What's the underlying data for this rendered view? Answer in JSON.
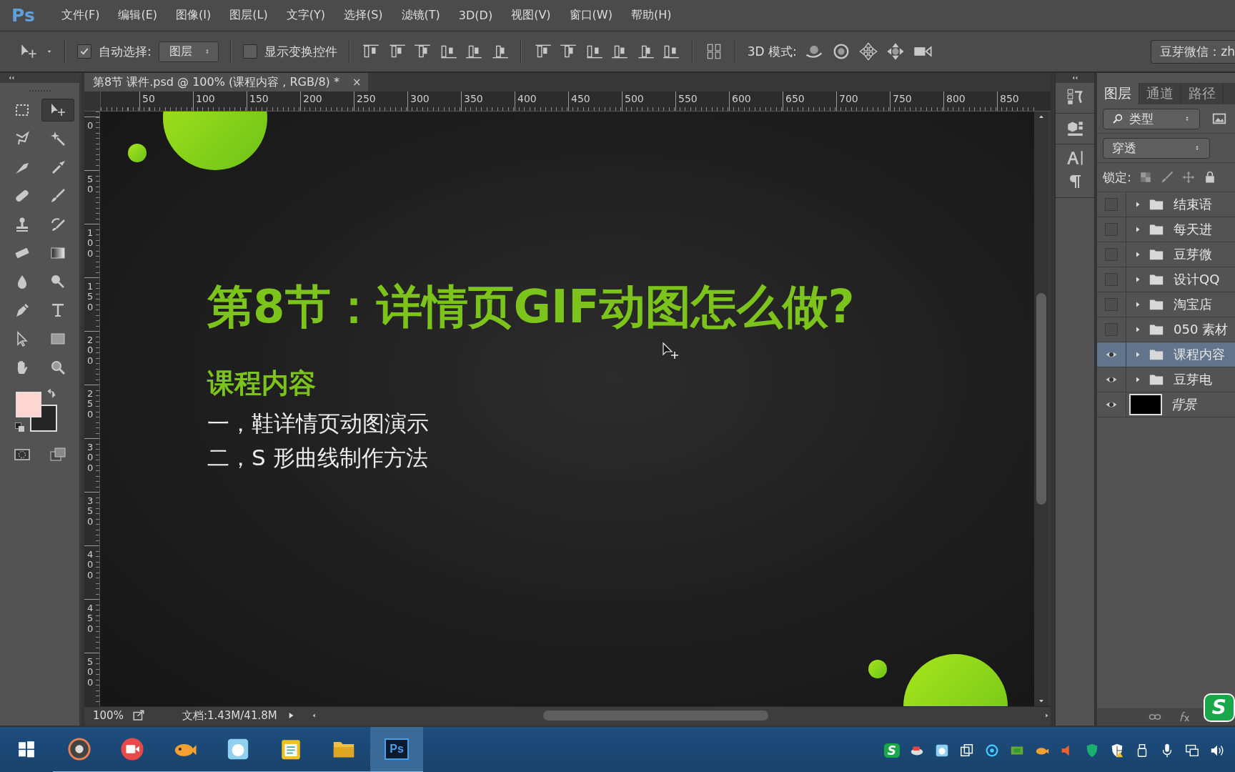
{
  "app": {
    "logo": "Ps"
  },
  "menu": [
    "文件(F)",
    "编辑(E)",
    "图像(I)",
    "图层(L)",
    "文字(Y)",
    "选择(S)",
    "滤镜(T)",
    "3D(D)",
    "视图(V)",
    "窗口(W)",
    "帮助(H)"
  ],
  "options_bar": {
    "auto_select": {
      "label": "自动选择:",
      "checked": true
    },
    "auto_select_target": "图层",
    "show_transform": {
      "label": "显示变换控件",
      "checked": false
    },
    "mode_3d_label": "3D 模式:",
    "workspace": "豆芽微信：zh"
  },
  "document": {
    "tab_title": "第8节 课件.psd @ 100% (课程内容 , RGB/8) *",
    "tab_close": "×",
    "h_ruler": [
      "50",
      "100",
      "150",
      "200",
      "250",
      "300",
      "350",
      "400",
      "450",
      "500",
      "550",
      "600",
      "650",
      "700",
      "750",
      "800",
      "850"
    ],
    "v_ruler": [
      "0",
      "50",
      "100",
      "150",
      "200",
      "250",
      "300",
      "350",
      "400",
      "450",
      "500"
    ],
    "title": "第8节：详情页GIF动图怎么做?",
    "heading": "课程内容",
    "lines": [
      "一，鞋详情页动图演示",
      "二，S 形曲线制作方法"
    ]
  },
  "status_bar": {
    "zoom": "100%",
    "doc_info": "文档:1.43M/41.8M"
  },
  "layers_panel": {
    "tabs": [
      {
        "label": "图层",
        "selected": true
      },
      {
        "label": "通道",
        "selected": false
      },
      {
        "label": "路径",
        "selected": false
      }
    ],
    "filter": "类型",
    "blend_mode": "穿透",
    "lock_label": "锁定:",
    "layers": [
      {
        "name": "结束语",
        "kind": "group",
        "visible": false,
        "selected": false
      },
      {
        "name": "每天进",
        "kind": "group",
        "visible": false,
        "selected": false
      },
      {
        "name": "豆芽微",
        "kind": "group",
        "visible": false,
        "selected": false
      },
      {
        "name": "设计QQ",
        "kind": "group",
        "visible": false,
        "selected": false
      },
      {
        "name": "淘宝店",
        "kind": "group",
        "visible": false,
        "selected": false
      },
      {
        "name": "050 素材",
        "kind": "group",
        "visible": false,
        "selected": false
      },
      {
        "name": "课程内容",
        "kind": "group",
        "visible": true,
        "selected": true
      },
      {
        "name": "豆芽电",
        "kind": "group",
        "visible": true,
        "selected": false
      },
      {
        "name": "背景",
        "kind": "image",
        "visible": true,
        "selected": false
      }
    ]
  },
  "taskbar": {
    "ps_label": "Ps",
    "ime_badge": "S"
  },
  "overlay_badge": "S"
}
